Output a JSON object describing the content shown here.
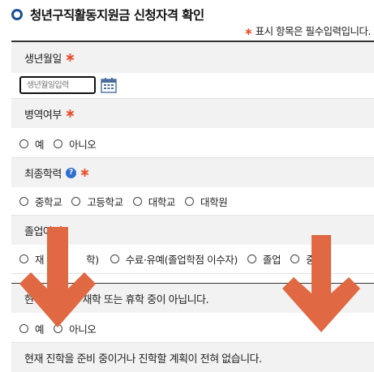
{
  "header": {
    "title": "청년구직활동지원금 신청자격 확인",
    "required_mark": "∗",
    "required_note": "표시 항목은 필수입력입니다."
  },
  "birth": {
    "label": "생년월일",
    "placeholder": "생년월일입력",
    "calendar_icon": "calendar-icon"
  },
  "military": {
    "label": "병역여부",
    "options": [
      "예",
      "아니오"
    ]
  },
  "education": {
    "label": "최종학력",
    "help_icon": "?",
    "options": [
      "중학교",
      "고등학교",
      "대학교",
      "대학원"
    ]
  },
  "graduation": {
    "label_visible": "졸업여",
    "options_visible": [
      "재",
      "학)",
      "수료·유예(졸업학점 이수자)",
      "졸업",
      "중"
    ]
  },
  "enrollment": {
    "question_start": "현",
    "question_end": "재학 또는 휴학 중이 아닙니다.",
    "options": [
      "예",
      "아니오"
    ]
  },
  "next_question": {
    "text": "현재 진학을 준비 중이거나 진학할 계획이 전혀 없습니다."
  },
  "overlay": {
    "arrow_color": "#e06843",
    "arrow_icon": "down-arrow-icon"
  }
}
